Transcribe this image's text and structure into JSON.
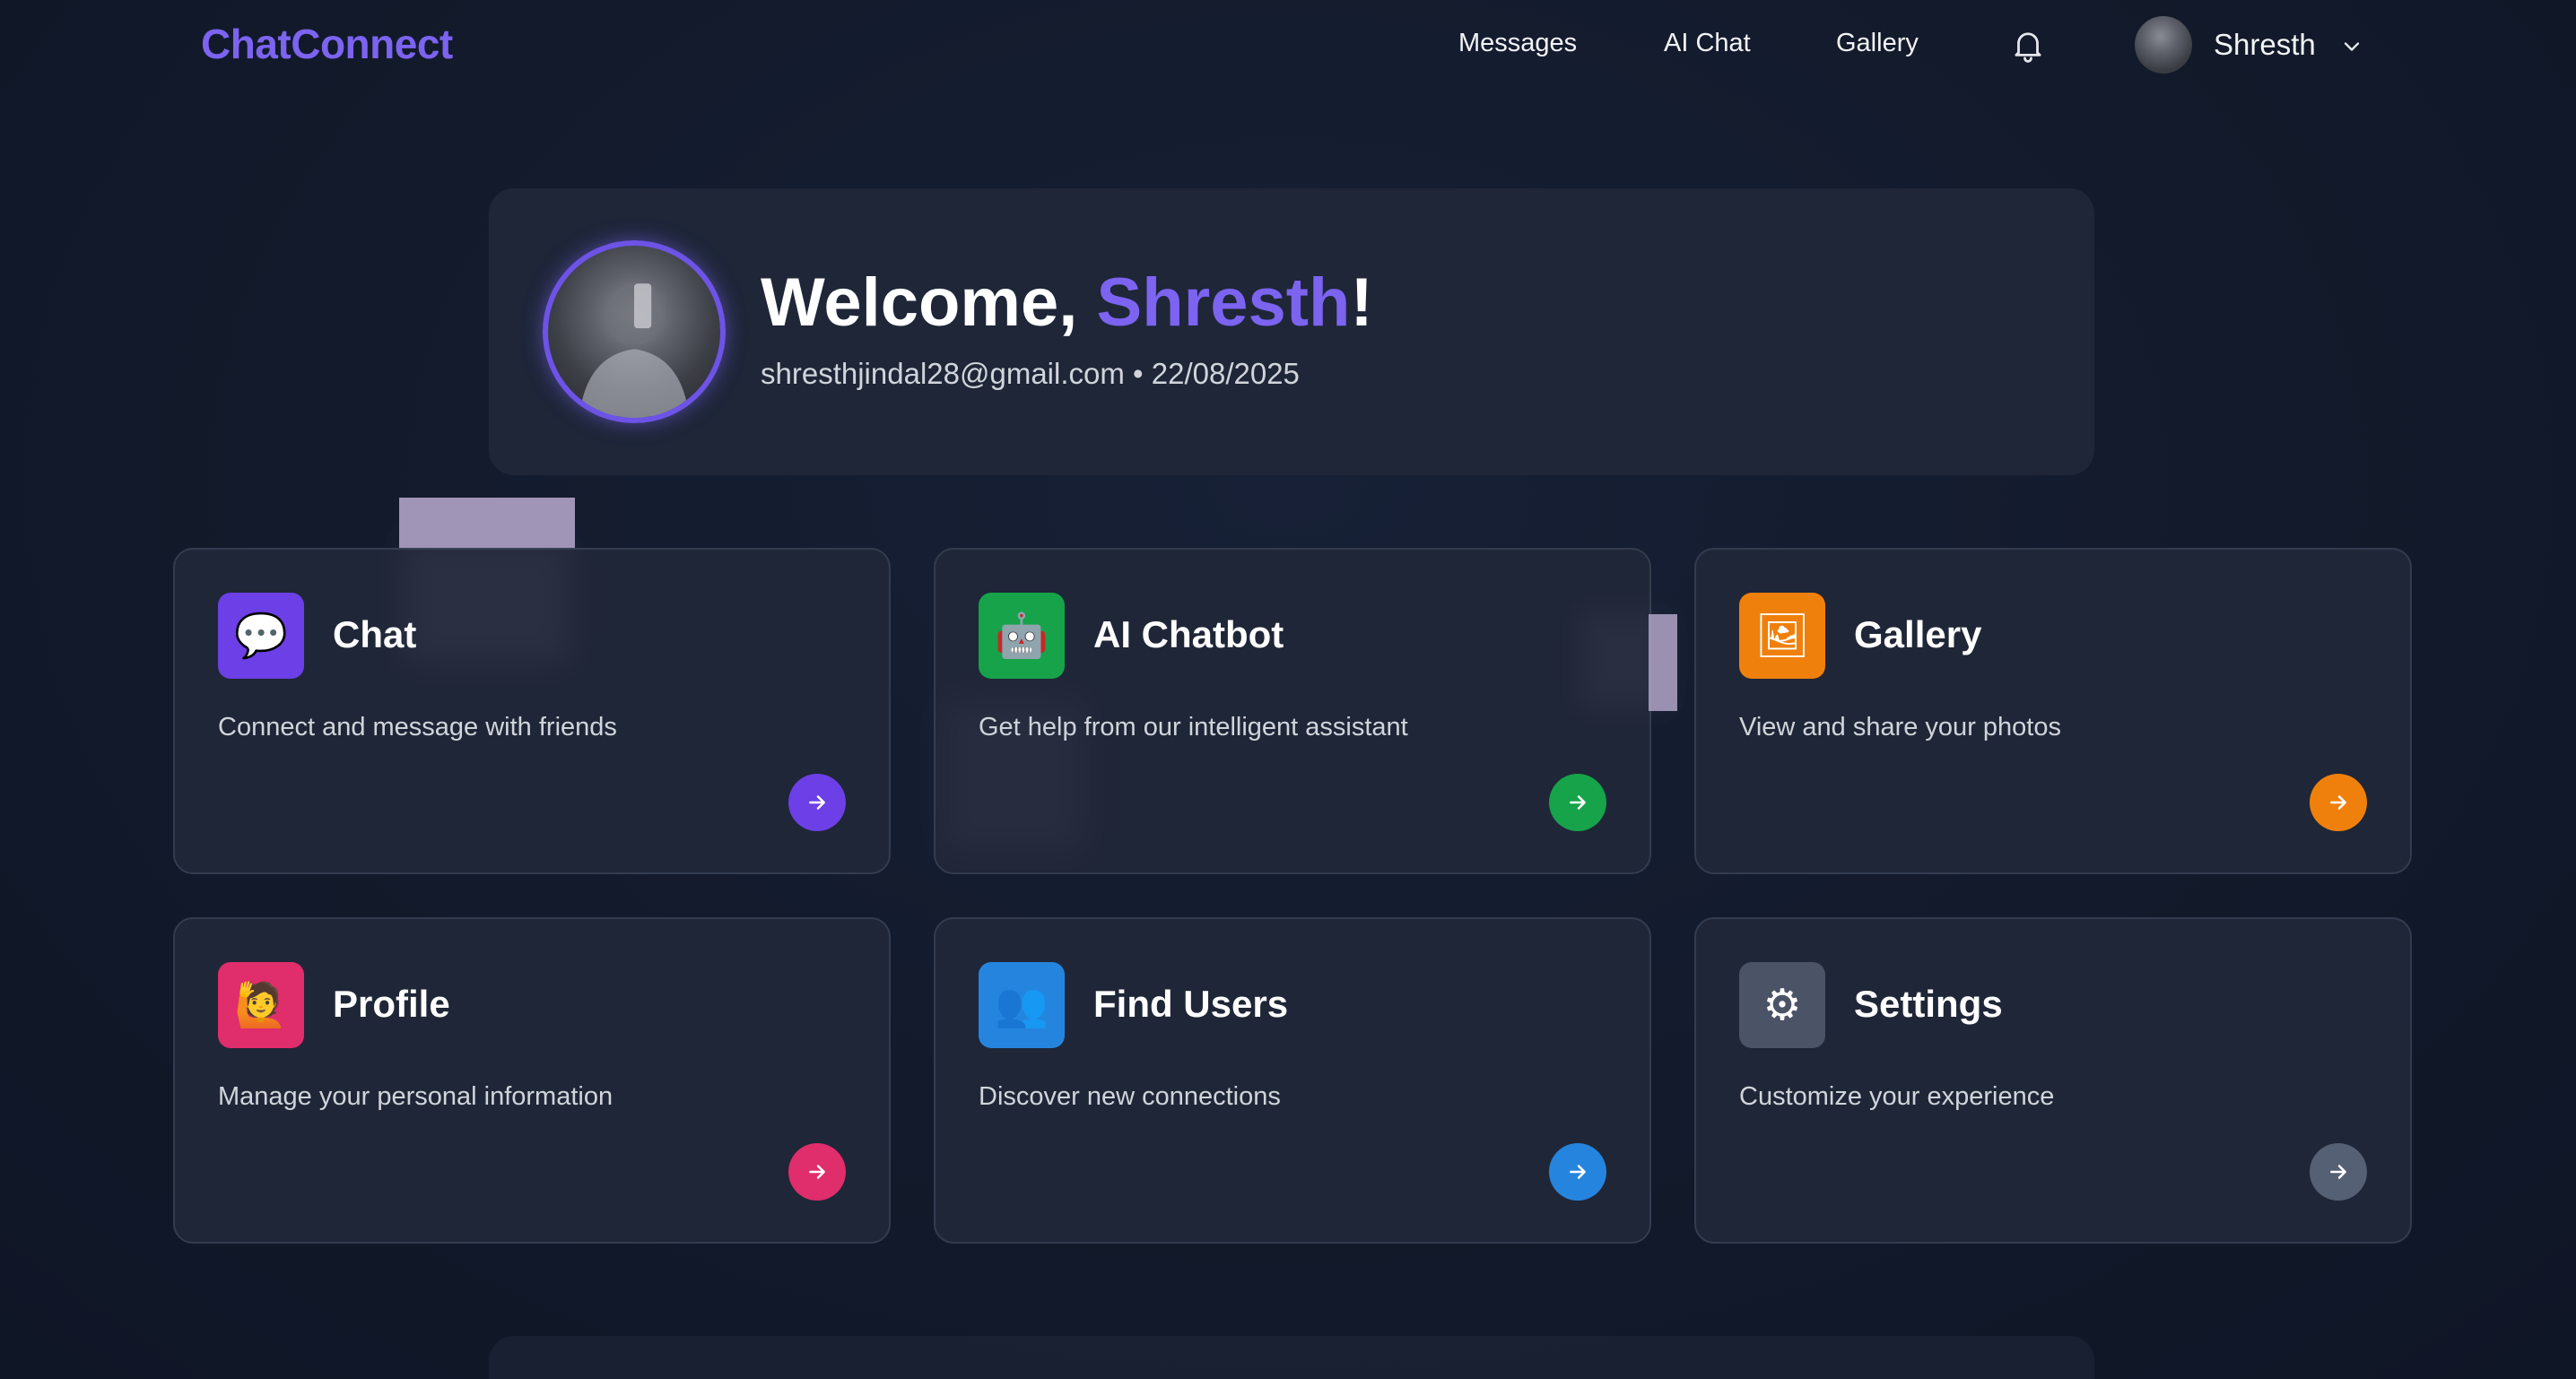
{
  "app": {
    "logo": "ChatConnect"
  },
  "nav": {
    "links": [
      "Messages",
      "AI Chat",
      "Gallery"
    ],
    "user_name": "Shresth",
    "icons": {
      "notifications": "bell-icon",
      "user_menu": "chevron-down-icon"
    }
  },
  "welcome": {
    "greeting_prefix": "Welcome, ",
    "name": "Shresth",
    "greeting_suffix": "!",
    "email": "shresthjindal28@gmail.com",
    "separator": " • ",
    "date": "22/08/2025"
  },
  "cards": [
    {
      "title": "Chat",
      "description": "Connect and message with friends",
      "icon": "💬",
      "icon_name": "speech-bubble-icon",
      "color": "#6d3fe6",
      "arrow_color": "#6d3fe6"
    },
    {
      "title": "AI Chatbot",
      "description": "Get help from our intelligent assistant",
      "icon": "🤖",
      "icon_name": "robot-icon",
      "color": "#16a34a",
      "arrow_color": "#16a34a"
    },
    {
      "title": "Gallery",
      "description": "View and share your photos",
      "icon": "🖼",
      "icon_name": "framed-picture-icon",
      "color": "#f0800c",
      "arrow_color": "#f0800c"
    },
    {
      "title": "Profile",
      "description": "Manage your personal information",
      "icon": "🙋",
      "icon_name": "person-raising-hand-icon",
      "color": "#e02d6b",
      "arrow_color": "#e02d6b"
    },
    {
      "title": "Find Users",
      "description": "Discover new connections",
      "icon": "👥",
      "icon_name": "people-icon",
      "color": "#2585de",
      "arrow_color": "#2585de"
    },
    {
      "title": "Settings",
      "description": "Customize your experience",
      "icon": "⚙",
      "icon_name": "gear-icon",
      "color": "#4b5366",
      "arrow_color": "#566074"
    }
  ]
}
